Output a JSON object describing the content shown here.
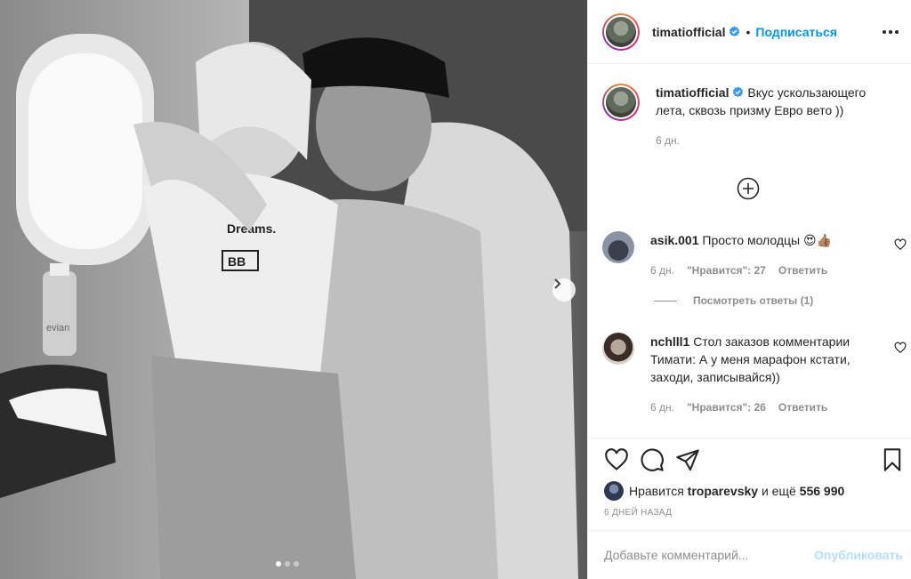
{
  "header": {
    "username": "timatiofficial",
    "follow_label": "Подписаться"
  },
  "caption": {
    "username": "timatiofficial",
    "text": "Вкус ускользающего лета, сквозь призму Евро вето ))",
    "time": "6 дн."
  },
  "comments": [
    {
      "username": "asik.001",
      "text": "Просто молодцы 😍👍🏽",
      "time": "6 дн.",
      "likes": "\"Нравится\": 27",
      "reply": "Ответить"
    },
    {
      "username": "nchlll1",
      "text": "Стол заказов комментарии Тимати: А у меня марафон кстати, заходи, записывайся))",
      "time": "6 дн.",
      "likes": "\"Нравится\": 26",
      "reply": "Ответить"
    }
  ],
  "view_replies": "Посмотреть ответы (1)",
  "likes_line": {
    "prefix": "Нравится",
    "user": "troparevsky",
    "mid": "и ещё",
    "count": "556 990"
  },
  "post_date": "6 ДНЕЙ НАЗАД",
  "add_comment": {
    "placeholder": "Добавьте комментарий...",
    "publish_label": "Опубликовать"
  },
  "photo": {
    "bottle_label": "evian",
    "sweater_text": "Dreams.",
    "sweater_tag": "BB"
  },
  "icons": {
    "heart": "heart-icon",
    "comment": "comment-icon",
    "share": "paper-plane-icon",
    "save": "bookmark-icon",
    "add": "plus-circle-icon",
    "more": "more-dots-icon",
    "next": "chevron-right-icon",
    "verified": "verified-badge-icon"
  },
  "colors": {
    "accent": "#0095f6",
    "muted": "#8e8e8e",
    "publish_disabled": "#b2dffc"
  },
  "carousel": {
    "total": 3,
    "active": 1
  }
}
